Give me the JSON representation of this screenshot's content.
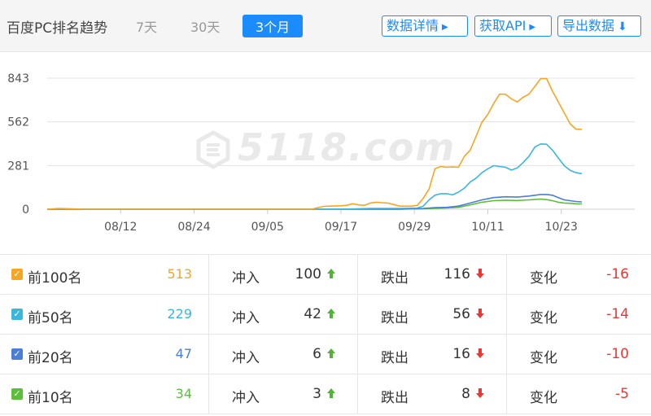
{
  "header": {
    "title": "百度PC排名趋势",
    "range_tabs": [
      {
        "label": "7天",
        "active": false
      },
      {
        "label": "30天",
        "active": false
      },
      {
        "label": "3个月",
        "active": true
      }
    ],
    "buttons": {
      "details": "数据详情",
      "api": "获取API",
      "export": "导出数据"
    }
  },
  "watermark": "5118.com",
  "chart_data": {
    "type": "line",
    "title": "",
    "ylabel": "",
    "xlabel": "",
    "ylim": [
      0,
      900
    ],
    "y_ticks": [
      0,
      281,
      562,
      843
    ],
    "x_tick_labels": [
      "08/12",
      "08/24",
      "09/05",
      "09/17",
      "09/29",
      "10/11",
      "10/23"
    ],
    "grid": true,
    "series": [
      {
        "color": "#f5a623",
        "values": [
          [
            0,
            0
          ],
          [
            2,
            5
          ],
          [
            4,
            3
          ],
          [
            6,
            0
          ],
          [
            10,
            0
          ],
          [
            20,
            0
          ],
          [
            30,
            0
          ],
          [
            40,
            0
          ],
          [
            45,
            0
          ],
          [
            46,
            10
          ],
          [
            47,
            18
          ],
          [
            48,
            20
          ],
          [
            50,
            22
          ],
          [
            51,
            25
          ],
          [
            52,
            35
          ],
          [
            53,
            28
          ],
          [
            54,
            25
          ],
          [
            55,
            40
          ],
          [
            56,
            45
          ],
          [
            57,
            42
          ],
          [
            58,
            40
          ],
          [
            59,
            30
          ],
          [
            60,
            20
          ],
          [
            61,
            20
          ],
          [
            62,
            20
          ],
          [
            63,
            25
          ],
          [
            64,
            70
          ],
          [
            65,
            130
          ],
          [
            66,
            260
          ],
          [
            67,
            275
          ],
          [
            68,
            270
          ],
          [
            69,
            272
          ],
          [
            70,
            270
          ],
          [
            71,
            340
          ],
          [
            72,
            380
          ],
          [
            73,
            470
          ],
          [
            74,
            560
          ],
          [
            75,
            610
          ],
          [
            76,
            680
          ],
          [
            77,
            740
          ],
          [
            78,
            740
          ],
          [
            79,
            710
          ],
          [
            80,
            690
          ],
          [
            81,
            720
          ],
          [
            82,
            740
          ],
          [
            83,
            790
          ],
          [
            84,
            840
          ],
          [
            85,
            840
          ],
          [
            86,
            760
          ],
          [
            87,
            690
          ],
          [
            88,
            620
          ],
          [
            89,
            550
          ],
          [
            90,
            515
          ],
          [
            91,
            513
          ]
        ]
      },
      {
        "color": "#3bb7dd",
        "values": [
          [
            0,
            0
          ],
          [
            40,
            0
          ],
          [
            50,
            0
          ],
          [
            55,
            5
          ],
          [
            60,
            5
          ],
          [
            63,
            8
          ],
          [
            64,
            20
          ],
          [
            65,
            60
          ],
          [
            66,
            90
          ],
          [
            67,
            100
          ],
          [
            68,
            100
          ],
          [
            69,
            92
          ],
          [
            70,
            110
          ],
          [
            71,
            135
          ],
          [
            72,
            175
          ],
          [
            73,
            200
          ],
          [
            74,
            235
          ],
          [
            75,
            260
          ],
          [
            76,
            280
          ],
          [
            77,
            275
          ],
          [
            78,
            270
          ],
          [
            79,
            252
          ],
          [
            80,
            265
          ],
          [
            81,
            300
          ],
          [
            82,
            340
          ],
          [
            83,
            400
          ],
          [
            84,
            420
          ],
          [
            85,
            418
          ],
          [
            86,
            380
          ],
          [
            87,
            330
          ],
          [
            88,
            280
          ],
          [
            89,
            250
          ],
          [
            90,
            235
          ],
          [
            91,
            229
          ]
        ]
      },
      {
        "color": "#4a7ed8",
        "values": [
          [
            0,
            0
          ],
          [
            60,
            0
          ],
          [
            64,
            5
          ],
          [
            66,
            10
          ],
          [
            68,
            12
          ],
          [
            70,
            20
          ],
          [
            72,
            40
          ],
          [
            74,
            60
          ],
          [
            76,
            75
          ],
          [
            78,
            80
          ],
          [
            80,
            78
          ],
          [
            82,
            85
          ],
          [
            84,
            95
          ],
          [
            85,
            95
          ],
          [
            86,
            90
          ],
          [
            87,
            75
          ],
          [
            88,
            60
          ],
          [
            89,
            55
          ],
          [
            90,
            50
          ],
          [
            91,
            47
          ]
        ]
      },
      {
        "color": "#5cbf3a",
        "values": [
          [
            0,
            0
          ],
          [
            60,
            0
          ],
          [
            64,
            3
          ],
          [
            66,
            6
          ],
          [
            68,
            8
          ],
          [
            70,
            12
          ],
          [
            72,
            28
          ],
          [
            74,
            45
          ],
          [
            76,
            55
          ],
          [
            78,
            58
          ],
          [
            80,
            56
          ],
          [
            82,
            60
          ],
          [
            84,
            65
          ],
          [
            85,
            62
          ],
          [
            86,
            55
          ],
          [
            87,
            45
          ],
          [
            88,
            40
          ],
          [
            89,
            38
          ],
          [
            90,
            35
          ],
          [
            91,
            34
          ]
        ]
      }
    ]
  },
  "rows": [
    {
      "label": "前100名",
      "color": "#f5a623",
      "value": "513",
      "in_label": "冲入",
      "in_value": "100",
      "out_label": "跌出",
      "out_value": "116",
      "chg_label": "变化",
      "chg_value": "-16"
    },
    {
      "label": "前50名",
      "color": "#3bb7dd",
      "value": "229",
      "in_label": "冲入",
      "in_value": "42",
      "out_label": "跌出",
      "out_value": "56",
      "chg_label": "变化",
      "chg_value": "-14"
    },
    {
      "label": "前20名",
      "color": "#4a7ed8",
      "value": "47",
      "in_label": "冲入",
      "in_value": "6",
      "out_label": "跌出",
      "out_value": "16",
      "chg_label": "变化",
      "chg_value": "-10"
    },
    {
      "label": "前10名",
      "color": "#5cbf3a",
      "value": "34",
      "in_label": "冲入",
      "in_value": "3",
      "out_label": "跌出",
      "out_value": "8",
      "chg_label": "变化",
      "chg_value": "-5"
    }
  ]
}
